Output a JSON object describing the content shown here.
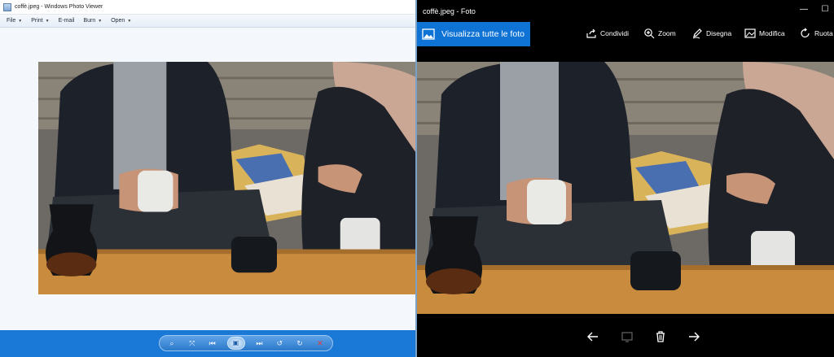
{
  "photo_viewer": {
    "title": "coffè.jpeg - Windows Photo Viewer",
    "menu": [
      {
        "label": "File"
      },
      {
        "label": "Print"
      },
      {
        "label": "E-mail"
      },
      {
        "label": "Burn"
      },
      {
        "label": "Open"
      }
    ],
    "toolbar_icons": [
      "zoom-icon",
      "fit-icon",
      "previous-icon",
      "slideshow-icon",
      "next-icon",
      "rotate-left-icon",
      "rotate-right-icon",
      "delete-icon"
    ]
  },
  "foto": {
    "title": "coffè.jpeg - Foto",
    "all_photos_label": "Visualizza tutte le foto",
    "commands": [
      {
        "label": "Condividi",
        "icon": "share-icon"
      },
      {
        "label": "Zoom",
        "icon": "zoom-icon"
      },
      {
        "label": "Disegna",
        "icon": "draw-icon"
      },
      {
        "label": "Modifica",
        "icon": "edit-icon"
      },
      {
        "label": "Ruota",
        "icon": "rotate-icon"
      }
    ],
    "bottom_icons": [
      "back-arrow-icon",
      "slideshow-icon",
      "delete-icon",
      "forward-arrow-icon"
    ]
  },
  "colors": {
    "accent_blue": "#0f73d6",
    "viewer_toolbar": "#1a78d6",
    "table_wood": "#c98b3e"
  }
}
